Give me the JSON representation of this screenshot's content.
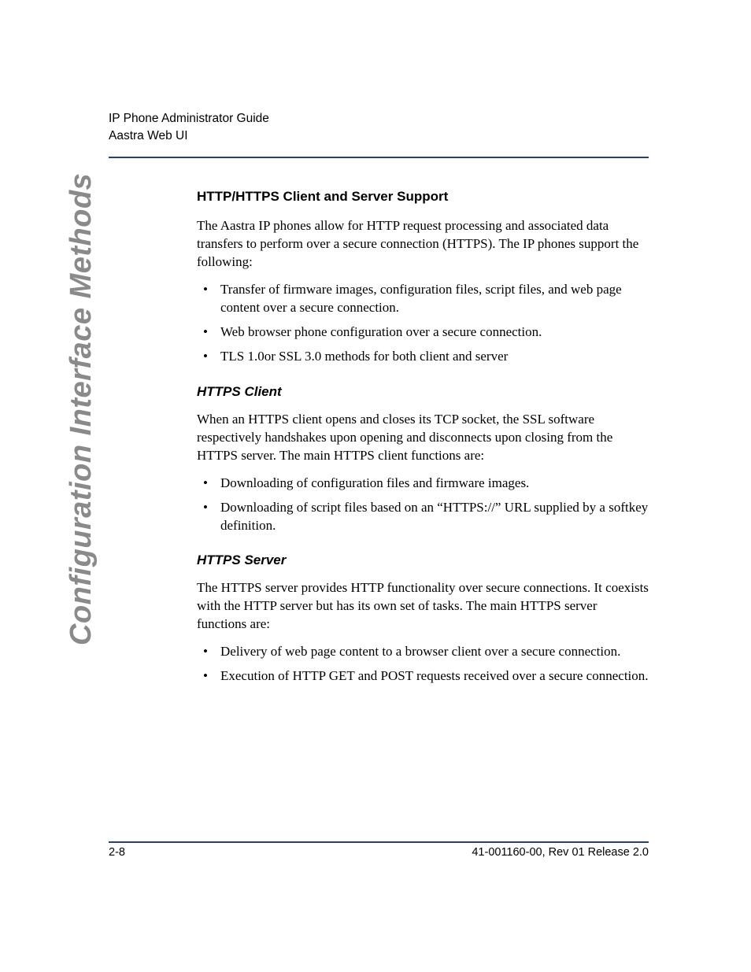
{
  "header": {
    "line1": "IP Phone Administrator Guide",
    "line2": "Aastra Web UI"
  },
  "side_label": "Configuration Interface Methods",
  "section1": {
    "heading": "HTTP/HTTPS Client and Server Support",
    "intro": "The Aastra IP phones allow for HTTP request processing and associated data transfers to perform over a secure connection (HTTPS). The IP phones support the following:",
    "bullets": [
      "Transfer of firmware images, configuration files, script files, and web page content over a secure connection.",
      "Web browser phone configuration over a secure connection.",
      "TLS 1.0or SSL 3.0 methods for both client and server"
    ]
  },
  "section2": {
    "heading": "HTTPS Client",
    "intro": "When an HTTPS client opens and closes its TCP socket, the SSL software respectively handshakes upon opening and disconnects upon closing from the HTTPS server. The main HTTPS client functions are:",
    "bullets": [
      "Downloading of configuration files and firmware images.",
      "Downloading of script files based on an “HTTPS://” URL supplied by a softkey definition."
    ]
  },
  "section3": {
    "heading": "HTTPS Server",
    "intro": "The HTTPS server provides HTTP functionality over secure connections. It coexists with the HTTP server but has its own set of tasks. The main HTTPS server functions are:",
    "bullets": [
      "Delivery of web page content to a browser client over a secure connection.",
      "Execution of HTTP GET and POST requests received over a secure connection."
    ]
  },
  "footer": {
    "left": "2-8",
    "right": "41-001160-00, Rev 01 Release 2.0"
  }
}
